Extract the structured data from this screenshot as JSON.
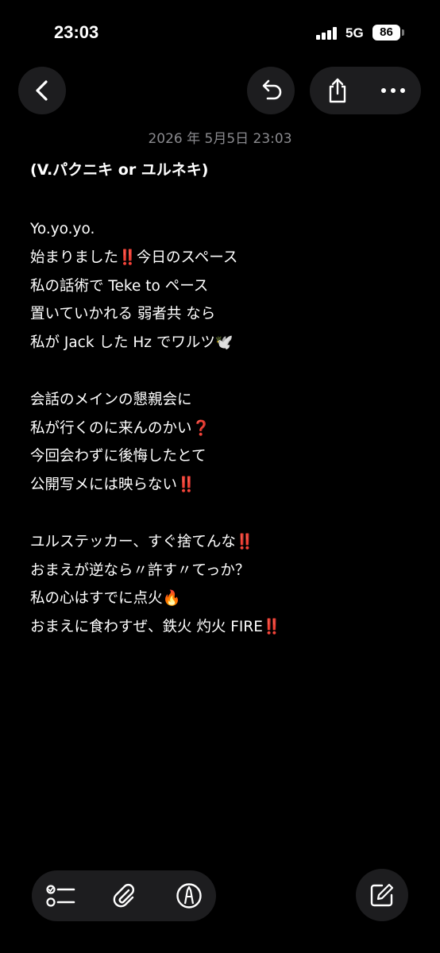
{
  "status_bar": {
    "time": "23:03",
    "network": "5G",
    "battery": "86"
  },
  "toolbar": {
    "back_icon": "chevron-left-icon",
    "undo_icon": "undo-icon",
    "share_icon": "share-icon",
    "more_icon": "more-icon"
  },
  "note": {
    "date": "2026 年 5月5日 23:03",
    "title": "(V.パクニキ or ユルネキ)",
    "lines": [
      "Yo.yo.yo.",
      "始まりました‼️今日のスペース",
      "私の話術で Teke to ペース",
      "置いていかれる 弱者共 なら",
      "私が Jack した Hz でワルツ🕊️",
      "",
      "会話のメインの懇親会に",
      "私が行くのに来んのかい❓",
      "今回会わずに後悔したとて",
      "公開写メには映らない‼️",
      "",
      "ユルステッカー、すぐ捨てんな‼️",
      "おまえが逆なら〃許す〃てっか？",
      "私の心はすでに点火🔥",
      "おまえに食わすぜ、鉄火 灼火 FIRE‼️"
    ]
  },
  "bottom_toolbar": {
    "checklist_icon": "checklist-icon",
    "attachment_icon": "paperclip-icon",
    "markup_icon": "pen-markup-icon",
    "compose_icon": "compose-icon"
  },
  "colors": {
    "background": "#000000",
    "button_background": "#1d1d1f",
    "text": "#ffffff",
    "secondary_text": "#8a8a8e"
  }
}
